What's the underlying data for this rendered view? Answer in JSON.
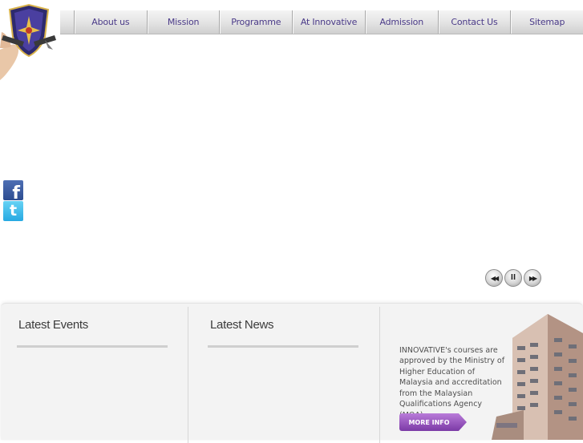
{
  "nav": {
    "items": [
      {
        "label": "About us"
      },
      {
        "label": "Mission"
      },
      {
        "label": "Programme"
      },
      {
        "label": "At Innovative"
      },
      {
        "label": "Admission"
      },
      {
        "label": "Contact Us"
      },
      {
        "label": "Sitemap"
      }
    ]
  },
  "social": {
    "facebook_icon": "facebook-icon",
    "twitter_icon": "twitter-icon"
  },
  "slider": {
    "prev_icon": "rewind-icon",
    "pause_icon": "pause-icon",
    "next_icon": "fast-forward-icon"
  },
  "events": {
    "title": "Latest Events"
  },
  "news": {
    "title": "Latest News"
  },
  "info": {
    "text": "INNOVATIVE's courses are approved by the Ministry of Higher Education of Malaysia and accreditation from the Malaysian Qualifications Agency (MQA).",
    "button_label": "MORE INFO"
  },
  "colors": {
    "nav_text": "#4a3a88",
    "button": "#8a47b5",
    "facebook": "#3b5998",
    "twitter": "#33b5e8"
  }
}
